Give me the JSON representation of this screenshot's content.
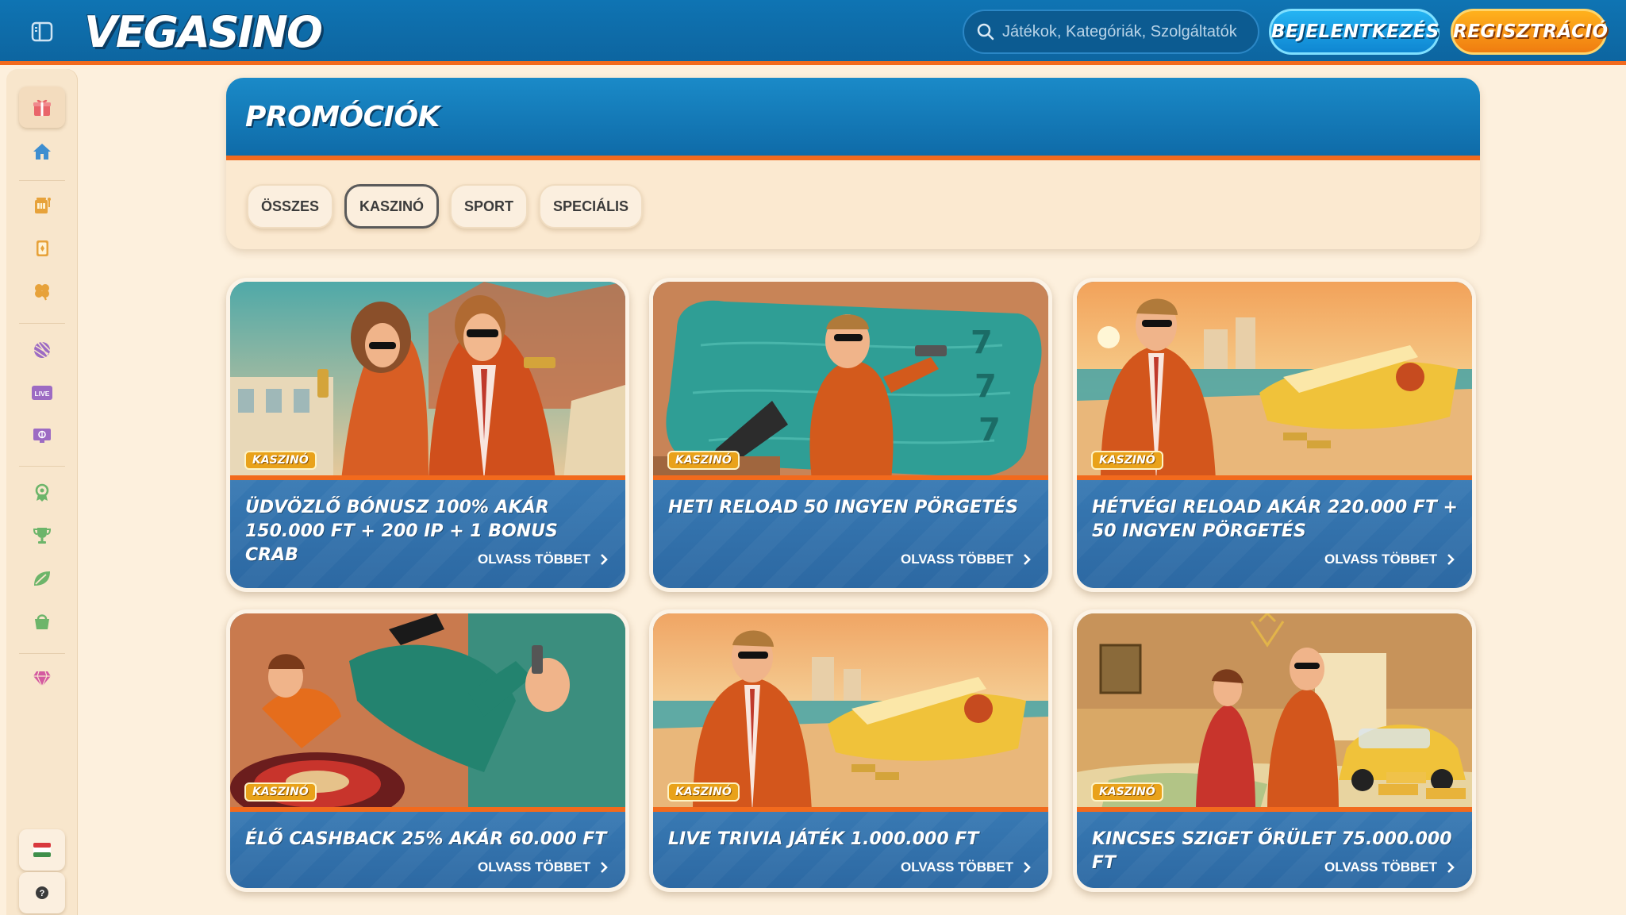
{
  "header": {
    "logo_text": "VEGASINO",
    "search_placeholder": "Játékok, Kategóriák, Szolgáltatók",
    "login_label": "BEJELENTKEZÉS",
    "register_label": "REGISZTRÁCIÓ"
  },
  "sidebar": {
    "items": [
      {
        "name": "gift-icon",
        "color": "#e9656a"
      },
      {
        "name": "home-icon",
        "color": "#3e8ed0"
      },
      {
        "name": "slots-icon",
        "color": "#e7a23a"
      },
      {
        "name": "card-icon",
        "color": "#e7a23a"
      },
      {
        "name": "clover-icon",
        "color": "#e7a23a"
      },
      {
        "name": "sport-ball-icon",
        "color": "#9d6bc3"
      },
      {
        "name": "live-icon",
        "color": "#9d6bc3"
      },
      {
        "name": "esport-icon",
        "color": "#9d6bc3"
      },
      {
        "name": "promo-icon",
        "color": "#6db56a"
      },
      {
        "name": "trophy-icon",
        "color": "#6db56a"
      },
      {
        "name": "leaf-icon",
        "color": "#6db56a"
      },
      {
        "name": "shop-icon",
        "color": "#6db56a"
      },
      {
        "name": "vip-diamond-icon",
        "color": "#d45aa0"
      }
    ],
    "language_flag": "hungary-flag-icon",
    "help_icon": "help-icon"
  },
  "promotions": {
    "title": "PROMÓCIÓK",
    "filters": [
      {
        "label": "ÖSSZES",
        "active": false
      },
      {
        "label": "KASZINÓ",
        "active": true
      },
      {
        "label": "SPORT",
        "active": false
      },
      {
        "label": "SPECIÁLIS",
        "active": false
      }
    ],
    "cards": [
      {
        "badge": "KASZINÓ",
        "title": "ÜDVÖZLŐ BÓNUSZ 100% AKÁR 150.000 FT + 200 IP + 1 BONUS CRAB",
        "more": "OLVASS TÖBBET"
      },
      {
        "badge": "KASZINÓ",
        "title": "HETI RELOAD 50 INGYEN PÖRGETÉS",
        "more": "OLVASS TÖBBET"
      },
      {
        "badge": "KASZINÓ",
        "title": "HÉTVÉGI RELOAD AKÁR 220.000 FT + 50 INGYEN PÖRGETÉS",
        "more": "OLVASS TÖBBET"
      },
      {
        "badge": "KASZINÓ",
        "title": "ÉLŐ CASHBACK 25% AKÁR 60.000 FT",
        "more": "OLVASS TÖBBET"
      },
      {
        "badge": "KASZINÓ",
        "title": "LIVE TRIVIA JÁTÉK 1.000.000 FT",
        "more": "OLVASS TÖBBET"
      },
      {
        "badge": "KASZINÓ",
        "title": "KINCSES SZIGET ŐRÜLET 75.000.000 FT",
        "more": "OLVASS TÖBBET"
      }
    ]
  },
  "colors": {
    "header_blue": "#0f74b3",
    "accent_orange": "#f26a1d",
    "page_bg": "#fdf0dd",
    "card_blue": "#2f6fa9",
    "badge_gold": "#e9a21a"
  }
}
